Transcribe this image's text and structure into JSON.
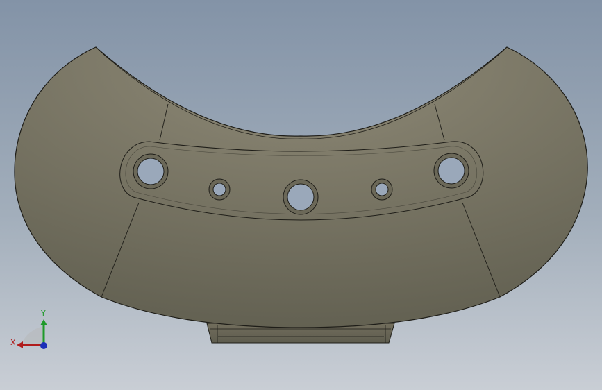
{
  "viewport": {
    "background_top": "#8393a7",
    "background_bottom": "#c9ced5"
  },
  "part": {
    "face_color_light": "#8f8a77",
    "face_color_dark": "#636152",
    "edge_color": "#1e1d18",
    "hole_color": "#9aa8ba"
  },
  "triad": {
    "x_label": "X",
    "y_label": "Y",
    "x_color": "#b01c1c",
    "y_color": "#1f9a2a",
    "z_color": "#1b2fb8"
  }
}
